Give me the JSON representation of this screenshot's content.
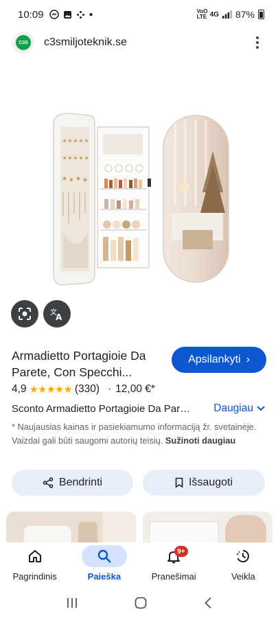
{
  "status_bar": {
    "time": "10:09",
    "network": "4G",
    "volte": "VoO LTE",
    "battery": "87%"
  },
  "site": {
    "logo_text": "C3S",
    "name": "c3smiljoteknik.se"
  },
  "product": {
    "title": "Armadietto Portagioie Da Parete, Con Specchi...",
    "visit_label": "Apsilankyti",
    "rating": "4,9",
    "review_count": "(330)",
    "price": "12,00 €*",
    "description": "Sconto Armadietto Portagioie Da Parete, Con Specchio",
    "more_label": "Daugiau",
    "disclaimer": "* Naujausias kainas ir pasiekiamumo informaciją žr. svetainėje. Vaizdai gali būti saugomi autorių teisių.",
    "disclaimer_link": "Sužinoti daugiau"
  },
  "actions": {
    "share_label": "Bendrinti",
    "save_label": "Išsaugoti"
  },
  "bottom_nav": {
    "items": [
      {
        "label": "Pagrindinis",
        "icon": "home-icon"
      },
      {
        "label": "Paieška",
        "icon": "search-icon"
      },
      {
        "label": "Pranešimai",
        "icon": "bell-icon",
        "badge": "9+"
      },
      {
        "label": "Veikla",
        "icon": "activity-icon"
      }
    ]
  },
  "colors": {
    "accent": "#0b57d0",
    "active_nav_bg": "#d3e3fd",
    "stars": "#f9ab00",
    "badge": "#d93025"
  }
}
